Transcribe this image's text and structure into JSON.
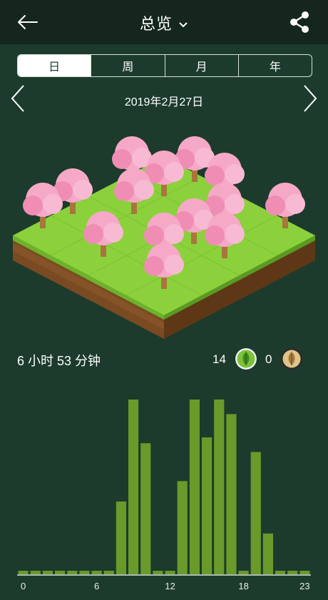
{
  "header": {
    "title": "总览"
  },
  "tabs": [
    {
      "label": "日",
      "active": true
    },
    {
      "label": "周",
      "active": false
    },
    {
      "label": "月",
      "active": false
    },
    {
      "label": "年",
      "active": false
    }
  ],
  "date": "2019年2月27日",
  "summary": {
    "duration": "6 小时 53 分钟",
    "success_count": "14",
    "fail_count": "0"
  },
  "colors": {
    "background": "#1c3b2c",
    "topbar": "#14261d",
    "bar": "#6a9a2a",
    "badge_success": "#7cc23a",
    "badge_fail": "#e0c48a"
  },
  "chart_data": {
    "type": "bar",
    "x": [
      0,
      1,
      2,
      3,
      4,
      5,
      6,
      7,
      8,
      9,
      10,
      11,
      12,
      13,
      14,
      15,
      16,
      17,
      18,
      19,
      20,
      21,
      22,
      23
    ],
    "tick_labels": [
      "0",
      "6",
      "12",
      "18",
      "23"
    ],
    "tick_positions": [
      0,
      6,
      12,
      18,
      23
    ],
    "values": [
      0,
      0,
      0,
      0,
      0,
      0,
      0,
      0,
      25,
      60,
      45,
      0,
      0,
      32,
      60,
      47,
      60,
      55,
      0,
      42,
      14,
      0,
      0,
      0
    ],
    "ylim": [
      0,
      60
    ],
    "xlabel": "",
    "ylabel": ""
  }
}
